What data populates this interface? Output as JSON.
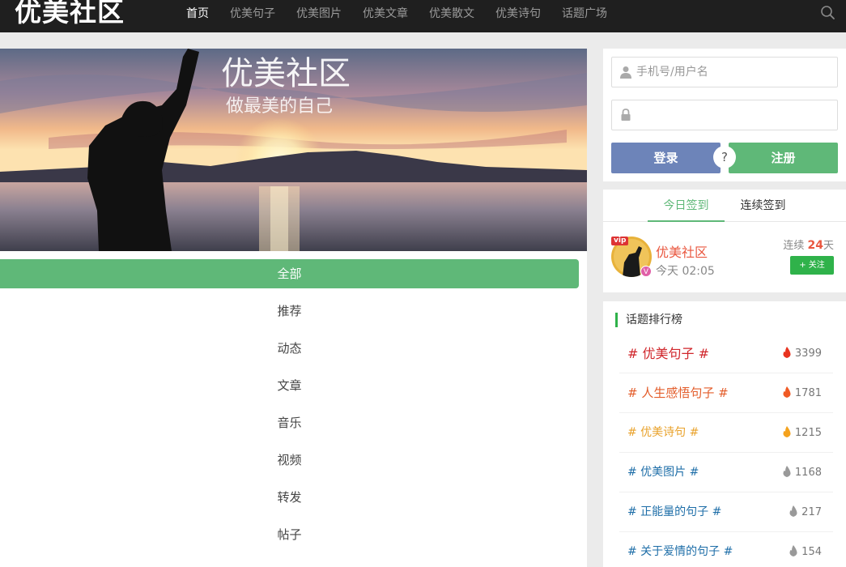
{
  "header": {
    "logo": "优美社区",
    "nav": [
      {
        "label": "首页",
        "active": true
      },
      {
        "label": "优美句子"
      },
      {
        "label": "优美图片"
      },
      {
        "label": "优美文章"
      },
      {
        "label": "优美散文"
      },
      {
        "label": "优美诗句"
      },
      {
        "label": "话题广场"
      }
    ],
    "search_icon": "search-icon"
  },
  "banner": {
    "title": "优美社区",
    "subtitle": "做最美的自己"
  },
  "filters": [
    {
      "label": "全部",
      "active": true
    },
    {
      "label": "推荐"
    },
    {
      "label": "动态"
    },
    {
      "label": "文章"
    },
    {
      "label": "音乐"
    },
    {
      "label": "视频"
    },
    {
      "label": "转发"
    },
    {
      "label": "帖子"
    }
  ],
  "login": {
    "username_placeholder": "手机号/用户名",
    "password_placeholder": "",
    "login_label": "登录",
    "register_label": "注册",
    "help_label": "?"
  },
  "signin": {
    "tabs": [
      {
        "label": "今日签到",
        "active": true
      },
      {
        "label": "连续签到"
      }
    ],
    "user_name": "优美社区",
    "time": "今天 02:05",
    "vip_label": "vip",
    "v_label": "V",
    "streak_prefix": "连续",
    "streak_days": "24",
    "streak_suffix": "天",
    "follow_label": "+ 关注"
  },
  "ranking": {
    "title": "话题排行榜",
    "items": [
      {
        "name": "# 优美句子 #",
        "count": "3399",
        "color": "#d0262b"
      },
      {
        "name": "# 人生感悟句子 #",
        "count": "1781",
        "color": "#e35d2b"
      },
      {
        "name": "# 优美诗句 #",
        "count": "1215",
        "color": "#e9a22b"
      },
      {
        "name": "# 优美图片 #",
        "count": "1168",
        "color": "#1e6ea8"
      },
      {
        "name": "# 正能量的句子 #",
        "count": "217",
        "color": "#1e6ea8"
      },
      {
        "name": "# 关于爱情的句子 #",
        "count": "154",
        "color": "#1e6ea8"
      }
    ]
  },
  "colors": {
    "accent_green": "#5fb878",
    "login_blue": "#6d84b9",
    "topbar": "#1f1f1f"
  }
}
